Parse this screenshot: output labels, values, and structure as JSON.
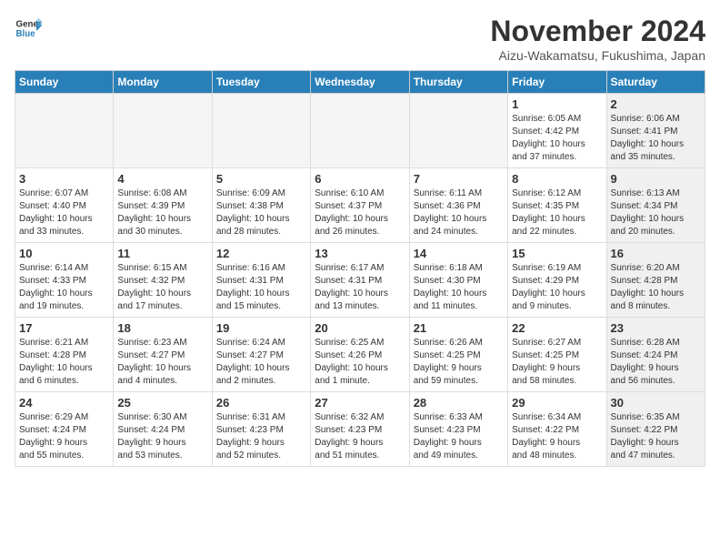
{
  "header": {
    "logo_line1": "General",
    "logo_line2": "Blue",
    "month": "November 2024",
    "location": "Aizu-Wakamatsu, Fukushima, Japan"
  },
  "weekdays": [
    "Sunday",
    "Monday",
    "Tuesday",
    "Wednesday",
    "Thursday",
    "Friday",
    "Saturday"
  ],
  "weeks": [
    [
      {
        "day": "",
        "info": "",
        "empty": true
      },
      {
        "day": "",
        "info": "",
        "empty": true
      },
      {
        "day": "",
        "info": "",
        "empty": true
      },
      {
        "day": "",
        "info": "",
        "empty": true
      },
      {
        "day": "",
        "info": "",
        "empty": true
      },
      {
        "day": "1",
        "info": "Sunrise: 6:05 AM\nSunset: 4:42 PM\nDaylight: 10 hours\nand 37 minutes.",
        "shaded": false
      },
      {
        "day": "2",
        "info": "Sunrise: 6:06 AM\nSunset: 4:41 PM\nDaylight: 10 hours\nand 35 minutes.",
        "shaded": true
      }
    ],
    [
      {
        "day": "3",
        "info": "Sunrise: 6:07 AM\nSunset: 4:40 PM\nDaylight: 10 hours\nand 33 minutes.",
        "shaded": false
      },
      {
        "day": "4",
        "info": "Sunrise: 6:08 AM\nSunset: 4:39 PM\nDaylight: 10 hours\nand 30 minutes.",
        "shaded": false
      },
      {
        "day": "5",
        "info": "Sunrise: 6:09 AM\nSunset: 4:38 PM\nDaylight: 10 hours\nand 28 minutes.",
        "shaded": false
      },
      {
        "day": "6",
        "info": "Sunrise: 6:10 AM\nSunset: 4:37 PM\nDaylight: 10 hours\nand 26 minutes.",
        "shaded": false
      },
      {
        "day": "7",
        "info": "Sunrise: 6:11 AM\nSunset: 4:36 PM\nDaylight: 10 hours\nand 24 minutes.",
        "shaded": false
      },
      {
        "day": "8",
        "info": "Sunrise: 6:12 AM\nSunset: 4:35 PM\nDaylight: 10 hours\nand 22 minutes.",
        "shaded": false
      },
      {
        "day": "9",
        "info": "Sunrise: 6:13 AM\nSunset: 4:34 PM\nDaylight: 10 hours\nand 20 minutes.",
        "shaded": true
      }
    ],
    [
      {
        "day": "10",
        "info": "Sunrise: 6:14 AM\nSunset: 4:33 PM\nDaylight: 10 hours\nand 19 minutes.",
        "shaded": false
      },
      {
        "day": "11",
        "info": "Sunrise: 6:15 AM\nSunset: 4:32 PM\nDaylight: 10 hours\nand 17 minutes.",
        "shaded": false
      },
      {
        "day": "12",
        "info": "Sunrise: 6:16 AM\nSunset: 4:31 PM\nDaylight: 10 hours\nand 15 minutes.",
        "shaded": false
      },
      {
        "day": "13",
        "info": "Sunrise: 6:17 AM\nSunset: 4:31 PM\nDaylight: 10 hours\nand 13 minutes.",
        "shaded": false
      },
      {
        "day": "14",
        "info": "Sunrise: 6:18 AM\nSunset: 4:30 PM\nDaylight: 10 hours\nand 11 minutes.",
        "shaded": false
      },
      {
        "day": "15",
        "info": "Sunrise: 6:19 AM\nSunset: 4:29 PM\nDaylight: 10 hours\nand 9 minutes.",
        "shaded": false
      },
      {
        "day": "16",
        "info": "Sunrise: 6:20 AM\nSunset: 4:28 PM\nDaylight: 10 hours\nand 8 minutes.",
        "shaded": true
      }
    ],
    [
      {
        "day": "17",
        "info": "Sunrise: 6:21 AM\nSunset: 4:28 PM\nDaylight: 10 hours\nand 6 minutes.",
        "shaded": false
      },
      {
        "day": "18",
        "info": "Sunrise: 6:23 AM\nSunset: 4:27 PM\nDaylight: 10 hours\nand 4 minutes.",
        "shaded": false
      },
      {
        "day": "19",
        "info": "Sunrise: 6:24 AM\nSunset: 4:27 PM\nDaylight: 10 hours\nand 2 minutes.",
        "shaded": false
      },
      {
        "day": "20",
        "info": "Sunrise: 6:25 AM\nSunset: 4:26 PM\nDaylight: 10 hours\nand 1 minute.",
        "shaded": false
      },
      {
        "day": "21",
        "info": "Sunrise: 6:26 AM\nSunset: 4:25 PM\nDaylight: 9 hours\nand 59 minutes.",
        "shaded": false
      },
      {
        "day": "22",
        "info": "Sunrise: 6:27 AM\nSunset: 4:25 PM\nDaylight: 9 hours\nand 58 minutes.",
        "shaded": false
      },
      {
        "day": "23",
        "info": "Sunrise: 6:28 AM\nSunset: 4:24 PM\nDaylight: 9 hours\nand 56 minutes.",
        "shaded": true
      }
    ],
    [
      {
        "day": "24",
        "info": "Sunrise: 6:29 AM\nSunset: 4:24 PM\nDaylight: 9 hours\nand 55 minutes.",
        "shaded": false
      },
      {
        "day": "25",
        "info": "Sunrise: 6:30 AM\nSunset: 4:24 PM\nDaylight: 9 hours\nand 53 minutes.",
        "shaded": false
      },
      {
        "day": "26",
        "info": "Sunrise: 6:31 AM\nSunset: 4:23 PM\nDaylight: 9 hours\nand 52 minutes.",
        "shaded": false
      },
      {
        "day": "27",
        "info": "Sunrise: 6:32 AM\nSunset: 4:23 PM\nDaylight: 9 hours\nand 51 minutes.",
        "shaded": false
      },
      {
        "day": "28",
        "info": "Sunrise: 6:33 AM\nSunset: 4:23 PM\nDaylight: 9 hours\nand 49 minutes.",
        "shaded": false
      },
      {
        "day": "29",
        "info": "Sunrise: 6:34 AM\nSunset: 4:22 PM\nDaylight: 9 hours\nand 48 minutes.",
        "shaded": false
      },
      {
        "day": "30",
        "info": "Sunrise: 6:35 AM\nSunset: 4:22 PM\nDaylight: 9 hours\nand 47 minutes.",
        "shaded": true
      }
    ]
  ]
}
